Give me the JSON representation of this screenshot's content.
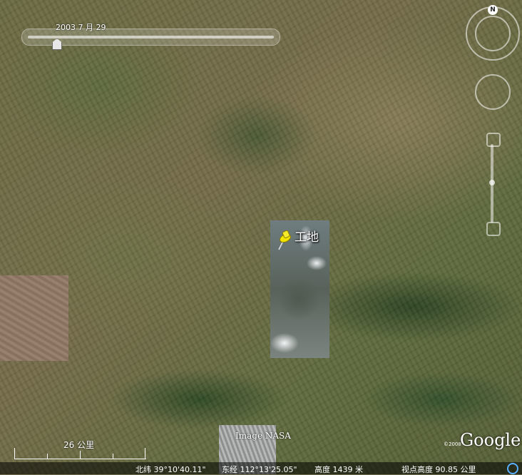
{
  "time_slider": {
    "date": "2003 7 月 29"
  },
  "compass": {
    "north_label": "N"
  },
  "placemark": {
    "label": "工地"
  },
  "imagery_credit": "Image NASA",
  "scale_bar": {
    "label": "26 公里"
  },
  "logo": {
    "text": "Google",
    "copyright": "©2008"
  },
  "status_bar": {
    "latitude": "北纬 39°10'40.11\"",
    "longitude": "东经 112°13'25.05\"",
    "elevation": "高度 1439 米",
    "eye_altitude": "视点高度   90.85 公里"
  },
  "colors": {
    "placemark": "#f3e400",
    "status_icon": "#5ab0ff"
  },
  "icons": {
    "pin": "pushpin-icon",
    "status": "streaming-icon"
  }
}
